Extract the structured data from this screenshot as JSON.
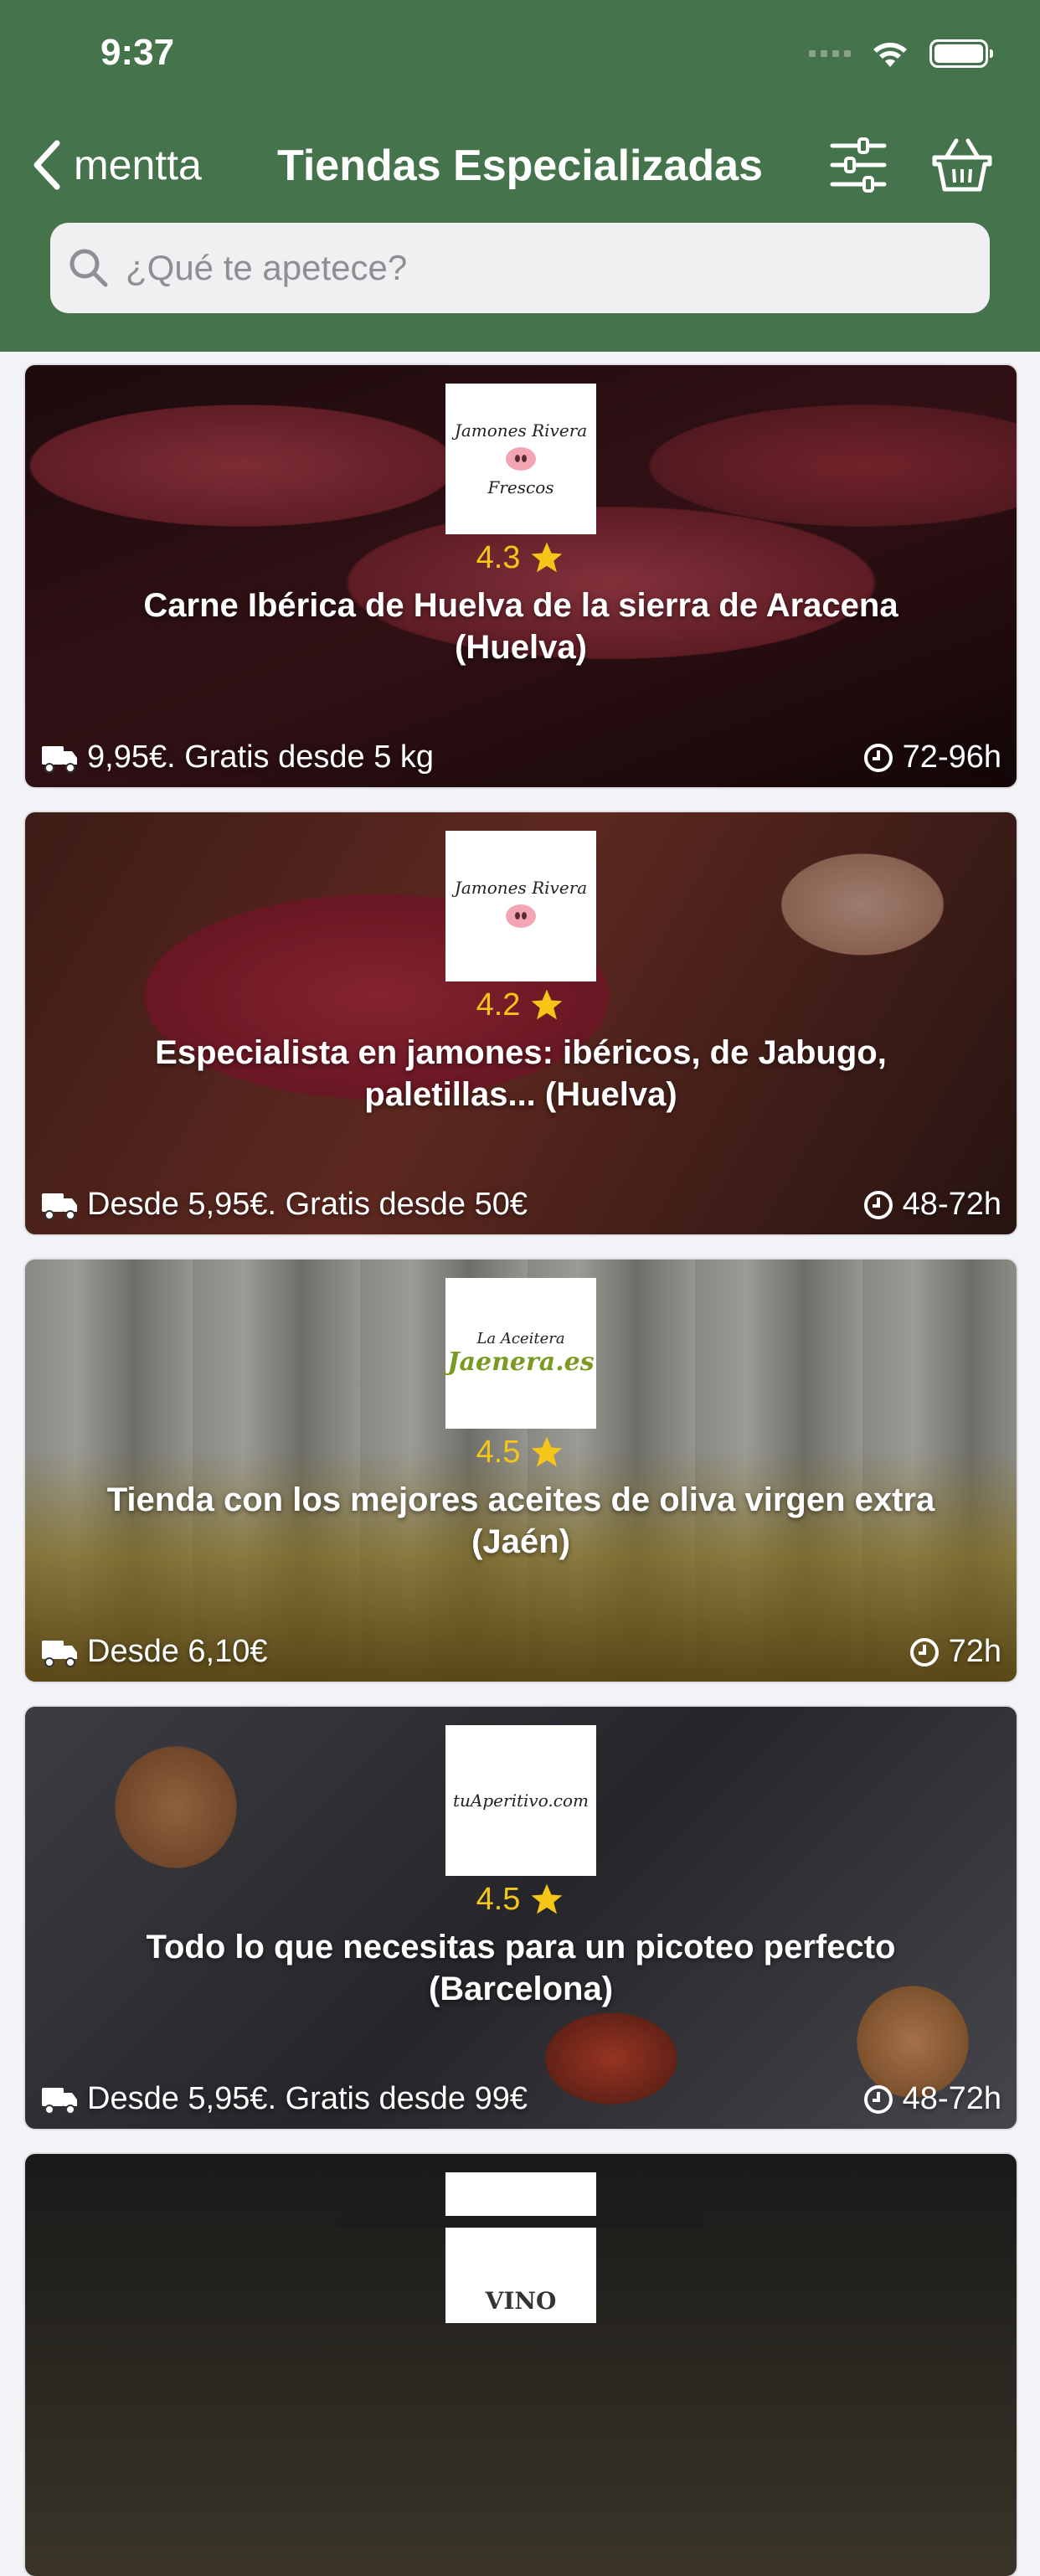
{
  "status_bar": {
    "time": "9:37"
  },
  "nav": {
    "back_label": "mentta",
    "title": "Tiendas Especializadas"
  },
  "search": {
    "placeholder": "¿Qué te apetece?"
  },
  "stores": [
    {
      "logo_line1": "Jamones Rivera",
      "logo_line2": "Frescos",
      "rating": "4.3",
      "title": "Carne Ibérica de Huelva de la sierra de Aracena (Huelva)",
      "shipping": "9,95€. Gratis desde 5 kg",
      "eta": "72-96h"
    },
    {
      "logo_line1": "Jamones Rivera",
      "logo_line2": "",
      "rating": "4.2",
      "title": "Especialista en jamones: ibéricos, de Jabugo, paletillas... (Huelva)",
      "shipping": "Desde 5,95€. Gratis desde 50€",
      "eta": "48-72h"
    },
    {
      "logo_line1": "La Aceitera",
      "logo_line2": "Jaenera.es",
      "rating": "4.5",
      "title": "Tienda con los mejores aceites de oliva virgen extra (Jaén)",
      "shipping": "Desde 6,10€",
      "eta": "72h"
    },
    {
      "logo_line1": "tuAperitivo.com",
      "logo_line2": "",
      "rating": "4.5",
      "title": "Todo lo que necesitas para un picoteo perfecto (Barcelona)",
      "shipping": "Desde 5,95€. Gratis desde 99€",
      "eta": "48-72h"
    },
    {
      "logo_line1": "VINO",
      "logo_line2": ""
    }
  ],
  "colors": {
    "header": "#44734c",
    "star": "#f5c518"
  }
}
